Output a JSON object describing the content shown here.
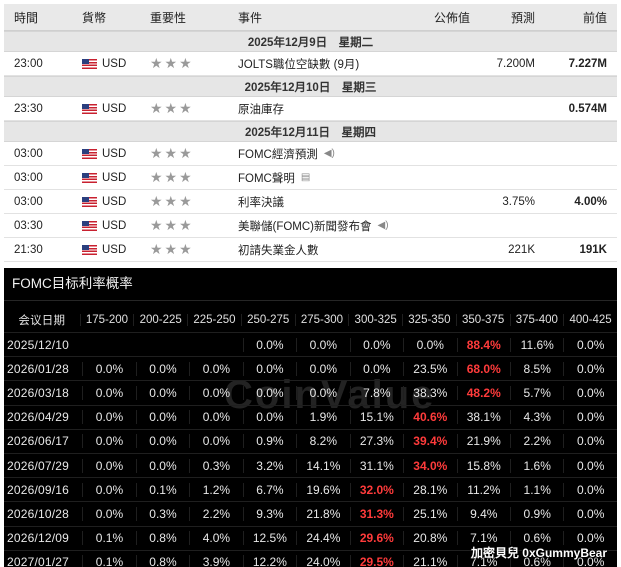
{
  "calendar": {
    "headers": {
      "time": "時間",
      "currency": "貨幣",
      "importance": "重要性",
      "event": "事件",
      "actual": "公佈值",
      "forecast": "預測",
      "previous": "前值"
    },
    "stars": "★★★",
    "groups": [
      {
        "date": "2025年12月9日　星期二",
        "events": [
          {
            "time": "23:00",
            "currency": "USD",
            "event": "JOLTS職位空缺數 (9月)",
            "actual": "",
            "forecast": "7.200M",
            "previous": "7.227M",
            "icon": ""
          }
        ]
      },
      {
        "date": "2025年12月10日　星期三",
        "events": [
          {
            "time": "23:30",
            "currency": "USD",
            "event": "原油庫存",
            "actual": "",
            "forecast": "",
            "previous": "0.574M",
            "icon": ""
          }
        ]
      },
      {
        "date": "2025年12月11日　星期四",
        "events": [
          {
            "time": "03:00",
            "currency": "USD",
            "event": "FOMC經濟預測",
            "actual": "",
            "forecast": "",
            "previous": "",
            "icon": "speaker-icon"
          },
          {
            "time": "03:00",
            "currency": "USD",
            "event": "FOMC聲明",
            "actual": "",
            "forecast": "",
            "previous": "",
            "icon": "document-icon"
          },
          {
            "time": "03:00",
            "currency": "USD",
            "event": "利率決議",
            "actual": "",
            "forecast": "3.75%",
            "previous": "4.00%",
            "icon": ""
          },
          {
            "time": "03:30",
            "currency": "USD",
            "event": "美聯儲(FOMC)新聞發布會",
            "actual": "",
            "forecast": "",
            "previous": "",
            "icon": "speaker-icon"
          },
          {
            "time": "21:30",
            "currency": "USD",
            "event": "初請失業金人數",
            "actual": "",
            "forecast": "221K",
            "previous": "191K",
            "icon": ""
          }
        ]
      }
    ]
  },
  "fomc": {
    "title": "FOMC目标利率概率",
    "headers": [
      "会议日期",
      "175-200",
      "200-225",
      "225-250",
      "250-275",
      "275-300",
      "300-325",
      "325-350",
      "350-375",
      "375-400",
      "400-425"
    ],
    "highlight_color": "#ff3b3b",
    "rows": [
      {
        "date": "2025/12/10",
        "values": [
          "",
          "",
          "",
          "0.0%",
          "0.0%",
          "0.0%",
          "0.0%",
          "88.4%",
          "11.6%",
          "0.0%"
        ],
        "hi": 7
      },
      {
        "date": "2026/01/28",
        "values": [
          "0.0%",
          "0.0%",
          "0.0%",
          "0.0%",
          "0.0%",
          "0.0%",
          "23.5%",
          "68.0%",
          "8.5%",
          "0.0%"
        ],
        "hi": 7
      },
      {
        "date": "2026/03/18",
        "values": [
          "0.0%",
          "0.0%",
          "0.0%",
          "0.0%",
          "0.0%",
          "7.8%",
          "38.3%",
          "48.2%",
          "5.7%",
          "0.0%"
        ],
        "hi": 7
      },
      {
        "date": "2026/04/29",
        "values": [
          "0.0%",
          "0.0%",
          "0.0%",
          "0.0%",
          "1.9%",
          "15.1%",
          "40.6%",
          "38.1%",
          "4.3%",
          "0.0%"
        ],
        "hi": 6
      },
      {
        "date": "2026/06/17",
        "values": [
          "0.0%",
          "0.0%",
          "0.0%",
          "0.9%",
          "8.2%",
          "27.3%",
          "39.4%",
          "21.9%",
          "2.2%",
          "0.0%"
        ],
        "hi": 6
      },
      {
        "date": "2026/07/29",
        "values": [
          "0.0%",
          "0.0%",
          "0.3%",
          "3.2%",
          "14.1%",
          "31.1%",
          "34.0%",
          "15.8%",
          "1.6%",
          "0.0%"
        ],
        "hi": 6
      },
      {
        "date": "2026/09/16",
        "values": [
          "0.0%",
          "0.1%",
          "1.2%",
          "6.7%",
          "19.6%",
          "32.0%",
          "28.1%",
          "11.2%",
          "1.1%",
          "0.0%"
        ],
        "hi": 5
      },
      {
        "date": "2026/10/28",
        "values": [
          "0.0%",
          "0.3%",
          "2.2%",
          "9.3%",
          "21.8%",
          "31.3%",
          "25.1%",
          "9.4%",
          "0.9%",
          "0.0%"
        ],
        "hi": 5
      },
      {
        "date": "2026/12/09",
        "values": [
          "0.1%",
          "0.8%",
          "4.0%",
          "12.5%",
          "24.4%",
          "29.6%",
          "20.8%",
          "7.1%",
          "0.6%",
          "0.0%"
        ],
        "hi": 5
      },
      {
        "date": "2027/01/27",
        "values": [
          "0.1%",
          "0.8%",
          "3.9%",
          "12.2%",
          "24.0%",
          "29.5%",
          "21.1%",
          "7.1%",
          "0.6%",
          "0.0%"
        ],
        "hi": 5
      }
    ],
    "watermark": "CoinValue",
    "credit": "加密貝兒 0xGummyBear"
  }
}
